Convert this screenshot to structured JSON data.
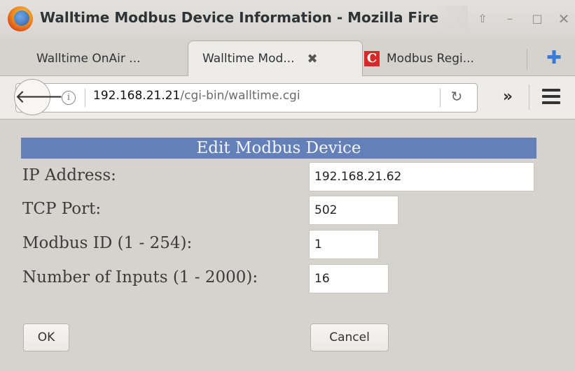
{
  "window": {
    "title": "Walltime Modbus Device Information - Mozilla Fire",
    "controls": {
      "up": "⇧",
      "minimize": "–",
      "maximize": "□",
      "close": "✕"
    }
  },
  "tabs": [
    {
      "label": "Walltime OnAir ...",
      "active": false
    },
    {
      "label": "Walltime Mod...",
      "active": true,
      "close": "✖"
    },
    {
      "label": "Modbus Regi...",
      "active": false,
      "icon": "C"
    }
  ],
  "new_tab_symbol": "✚",
  "nav": {
    "back_symbol": "🡐",
    "info_symbol": "i",
    "url_host": "192.168.21.21",
    "url_path": "/cgi-bin/walltime.cgi",
    "reload_symbol": "↻",
    "overflow_symbol": "»"
  },
  "form": {
    "header": "Edit Modbus Device",
    "fields": [
      {
        "label": "IP Address:",
        "value": "192.168.21.62"
      },
      {
        "label": "TCP Port:",
        "value": "502"
      },
      {
        "label": "Modbus ID (1 - 254):",
        "value": "1"
      },
      {
        "label": "Number of Inputs (1 - 2000):",
        "value": "16"
      }
    ],
    "ok_label": "OK",
    "cancel_label": "Cancel"
  },
  "colors": {
    "form_header_bg": "#6381b8",
    "page_bg": "#d6d2ce",
    "new_tab_icon": "#3a7bd5",
    "tab_favicon": "#d42a2a"
  }
}
